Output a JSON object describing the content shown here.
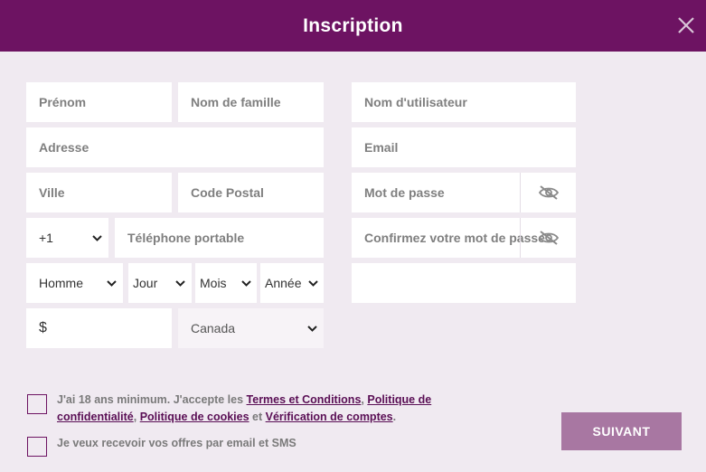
{
  "header": {
    "title": "Inscription",
    "close_icon": "close-icon"
  },
  "form": {
    "first_name": {
      "placeholder": "Prénom"
    },
    "last_name": {
      "placeholder": "Nom de famille"
    },
    "address": {
      "placeholder": "Adresse"
    },
    "city": {
      "placeholder": "Ville"
    },
    "postal_code": {
      "placeholder": "Code Postal"
    },
    "phone_code": {
      "value": "+1"
    },
    "mobile_phone": {
      "placeholder": "Téléphone portable"
    },
    "gender": {
      "value": "Homme"
    },
    "day": {
      "value": "Jour"
    },
    "month": {
      "value": "Mois"
    },
    "year": {
      "value": "Année"
    },
    "currency": {
      "value": "$"
    },
    "country": {
      "value": "Canada"
    },
    "username": {
      "placeholder": "Nom d'utilisateur"
    },
    "email": {
      "placeholder": "Email"
    },
    "password": {
      "placeholder": "Mot de passe",
      "icon": "eye-off-icon"
    },
    "confirm_password": {
      "placeholder": "Confirmez votre mot de passe",
      "icon": "eye-off-icon"
    },
    "extra_field": {
      "placeholder": ""
    }
  },
  "consent": {
    "age_prefix": "J'ai 18 ans minimum. J'accepte les ",
    "terms_link": "Termes et Conditions",
    "sep1": ", ",
    "privacy_link": "Politique de confidentialité",
    "sep2": ", ",
    "cookies_link": "Politique de cookies",
    "and": " et ",
    "verification_link": "Vérification de comptes",
    "end": ".",
    "sms_label": "Je veux recevoir vos offres par email et SMS"
  },
  "submit": {
    "label": "SUIVANT"
  },
  "colors": {
    "brand": "#6d1362",
    "background": "#f0eaf1",
    "button": "#a877a2",
    "link": "#5a0f55"
  }
}
